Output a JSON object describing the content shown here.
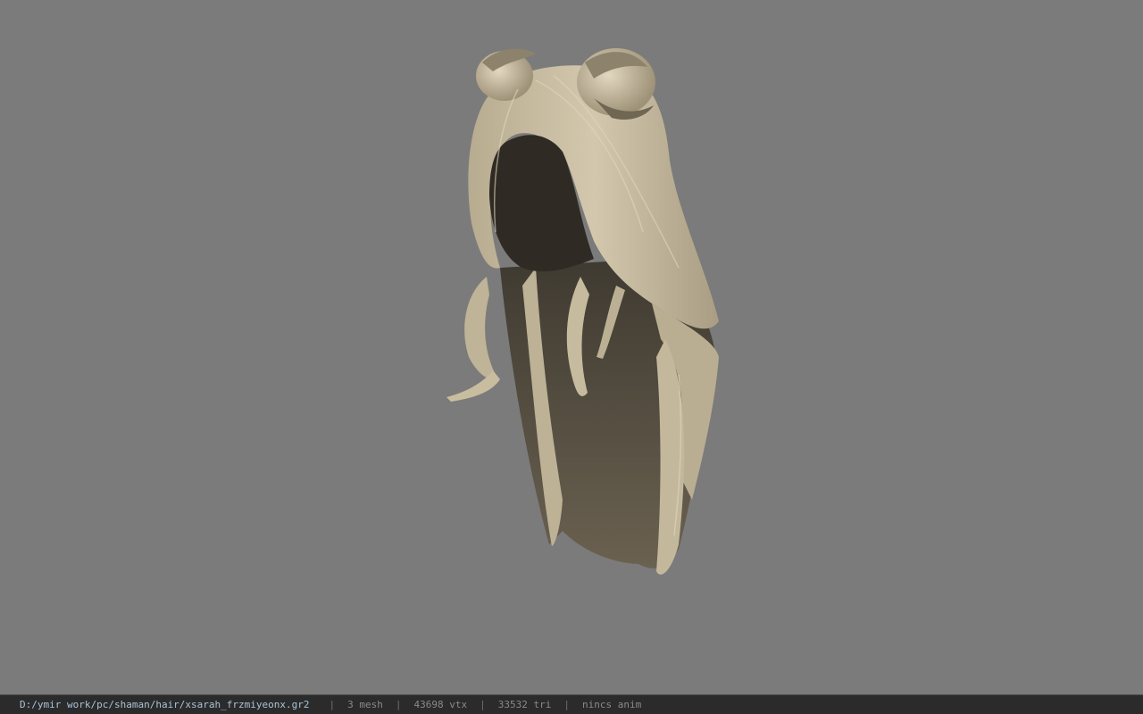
{
  "viewer": {
    "background_color": "#7b7b7b",
    "model_color": "#c9bc9e",
    "model_shadow_color": "#4f4a40"
  },
  "statusbar": {
    "file_path": "D:/ymir work/pc/shaman/hair/xsarah_frzmiyeonx.gr2",
    "separator": "|",
    "mesh_count": "3 mesh",
    "vertex_count": "43698 vtx",
    "triangle_count": "33532 tri",
    "animation_status": "nincs anim"
  }
}
